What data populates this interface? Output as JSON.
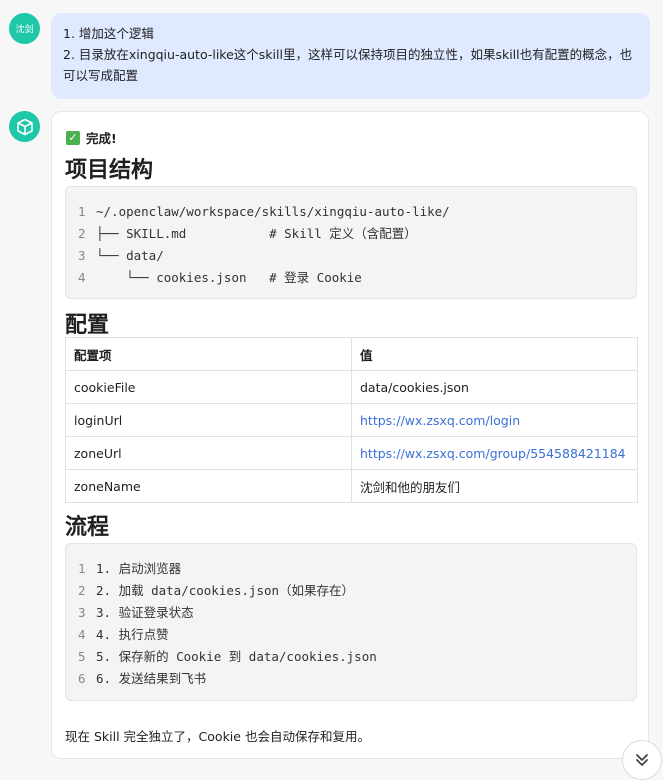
{
  "user": {
    "avatar_text": "沈剑",
    "message_line1": "1. 增加这个逻辑",
    "message_line2": "2. 目录放在xingqiu-auto-like这个skill里，这样可以保持项目的独立性，如果skill也有配置的概念，也可以写成配置"
  },
  "bot": {
    "avatar_icon": "cube-icon",
    "done_text": "完成!",
    "structure_heading": "项目结构",
    "structure_lines": [
      "~/.openclaw/workspace/skills/xingqiu-auto-like/",
      "├── SKILL.md           # Skill 定义（含配置）",
      "└── data/",
      "    └── cookies.json   # 登录 Cookie"
    ],
    "config_heading": "配置",
    "config_table": {
      "headers": [
        "配置项",
        "值"
      ],
      "rows": [
        [
          "cookieFile",
          "data/cookies.json"
        ],
        [
          "loginUrl",
          "https://wx.zsxq.com/login"
        ],
        [
          "zoneUrl",
          "https://wx.zsxq.com/group/554588421184"
        ],
        [
          "zoneName",
          "沈剑和他的朋友们"
        ]
      ]
    },
    "flow_heading": "流程",
    "flow_lines": [
      "1. 启动浏览器",
      "2. 加载 data/cookies.json（如果存在）",
      "3. 验证登录状态",
      "4. 执行点赞",
      "5. 保存新的 Cookie 到 data/cookies.json",
      "6. 发送结果到飞书"
    ],
    "footer": "现在 Skill 完全独立了，Cookie 也会自动保存和复用。"
  },
  "colors": {
    "accent": "#1ec7a8",
    "user_bubble": "#dfe9ff",
    "link": "#3a6fd8"
  }
}
